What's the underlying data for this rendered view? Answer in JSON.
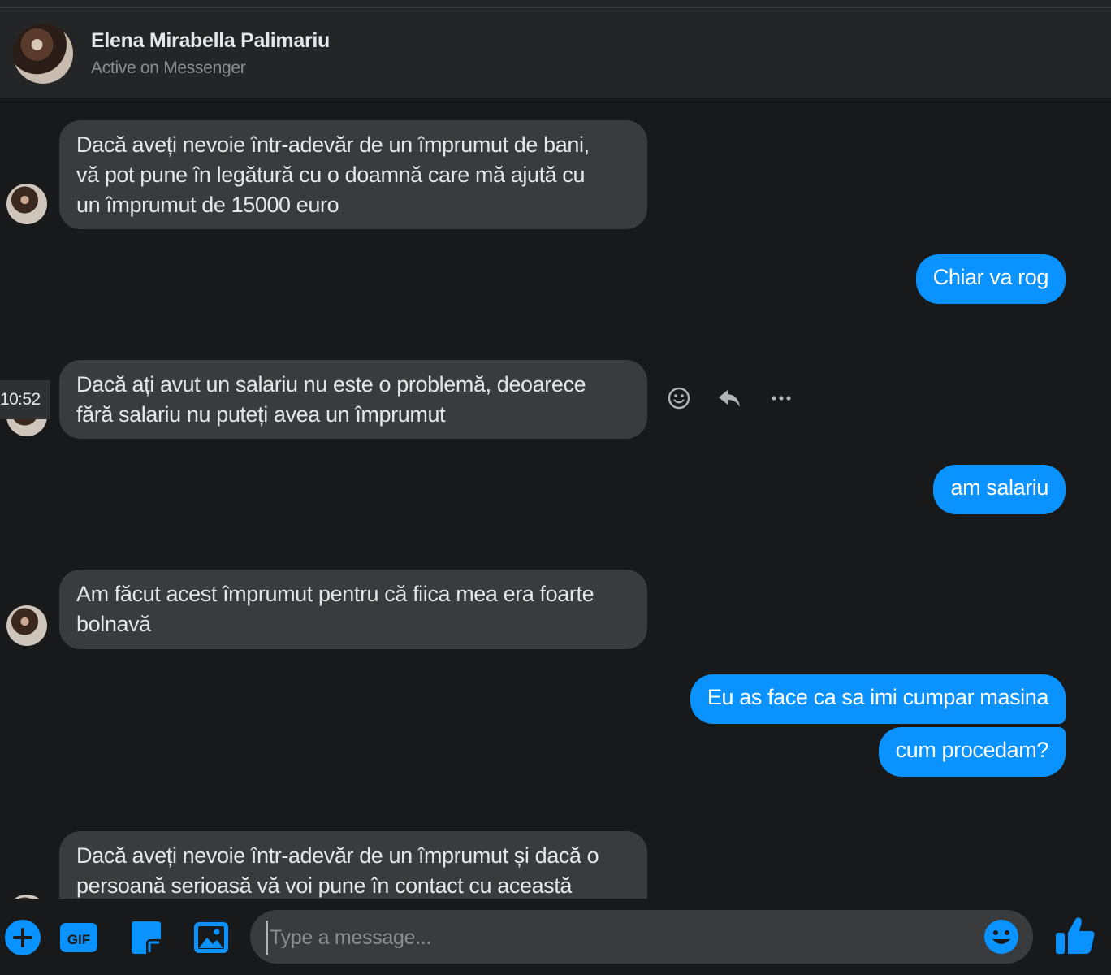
{
  "header": {
    "contact_name": "Elena Mirabella Palimariu",
    "status": "Active on Messenger"
  },
  "messages": [
    {
      "from": "contact",
      "text": "Dacă aveți nevoie într-adevăr de un împrumut de bani,\nvă pot pune în legătură cu o doamnă care mă ajută cu\nun împrumut de 15000 euro"
    },
    {
      "from": "me",
      "text": "Chiar va rog"
    },
    {
      "from": "contact",
      "text": "Dacă ați avut un salariu nu este o problemă, deoarece\nfără salariu nu puteți avea un împrumut"
    },
    {
      "from": "me",
      "text": "am salariu"
    },
    {
      "from": "contact",
      "text": "Am făcut acest împrumut pentru că fiica mea era foarte\nbolnavă"
    },
    {
      "from": "me",
      "text": "Eu as face ca sa imi cumpar masina"
    },
    {
      "from": "me",
      "text": "cum procedam?"
    },
    {
      "from": "contact",
      "text": "Dacă aveți nevoie într-adevăr de un împrumut și dacă o\npersoană serioasă vă voi pune în contact cu această"
    }
  ],
  "hover": {
    "timestamp": "10:52",
    "actions": [
      "react-icon",
      "reply-icon",
      "more-icon"
    ]
  },
  "composer": {
    "placeholder": "Type a message...",
    "value": "",
    "tools": [
      "plus-icon",
      "gif-icon",
      "sticker-icon",
      "image-icon"
    ],
    "gif_label": "GIF"
  },
  "colors": {
    "accent": "#0a93ff",
    "incoming_bubble": "#3a3b3c",
    "background": "#18191a"
  }
}
